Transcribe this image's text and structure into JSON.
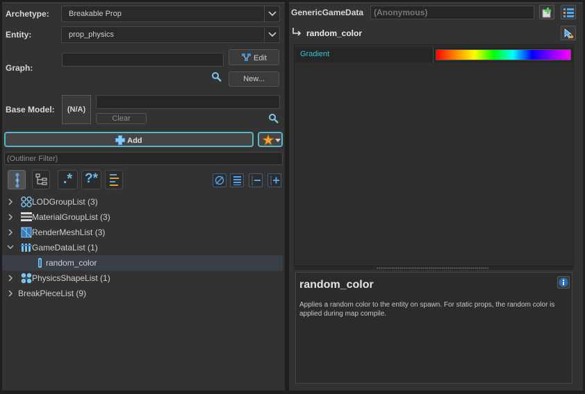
{
  "left": {
    "archetype": {
      "label": "Archetype:",
      "value": "Breakable Prop"
    },
    "entity": {
      "label": "Entity:",
      "value": "prop_physics"
    },
    "graph": {
      "label": "Graph:",
      "edit_label": "Edit",
      "new_label": "New..."
    },
    "base_model": {
      "label": "Base Model:",
      "thumb_text": "(N/A)",
      "clear_label": "Clear"
    },
    "add_label": "Add",
    "filter_placeholder": "(Outliner Filter)",
    "toolbar_texts": {
      "regex": ".*",
      "wildcard": "?*"
    },
    "tree": [
      {
        "label": "LODGroupList (3)",
        "icon": "lod-group-icon",
        "expanded": false
      },
      {
        "label": "MaterialGroupList (3)",
        "icon": "material-group-icon",
        "expanded": false
      },
      {
        "label": "RenderMeshList (3)",
        "icon": "render-mesh-icon",
        "expanded": false
      },
      {
        "label": "GameDataList (1)",
        "icon": "game-data-icon",
        "expanded": true
      },
      {
        "label": "random_color",
        "icon": "game-data-item-icon",
        "child": true,
        "selected": true
      },
      {
        "label": "PhysicsShapeList (1)",
        "icon": "physics-shape-icon",
        "expanded": false
      },
      {
        "label": "BreakPieceList (9)",
        "icon": "",
        "expanded": false
      }
    ]
  },
  "right": {
    "class_name": "GenericGameData",
    "instance_name": "(Anonymous)",
    "node_title": "random_color",
    "property": {
      "name": "Gradient",
      "colors": [
        "#ff0000",
        "#ff8800",
        "#ffff00",
        "#00ff00",
        "#00ffff",
        "#0000ff",
        "#8800ff",
        "#ff00ff"
      ]
    },
    "desc_title": "random_color",
    "desc_text": "Applies a random color to the entity on spawn. For static props, the random color is applied during map compile."
  },
  "colors": {
    "accent": "#2fc6d6",
    "selection": "#3a3f47",
    "info": "#2a6fb5"
  }
}
